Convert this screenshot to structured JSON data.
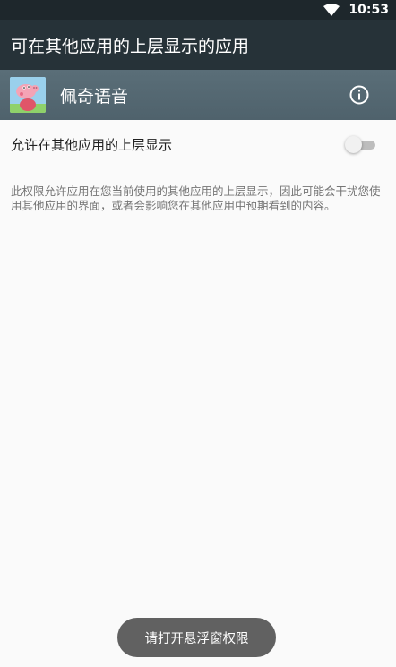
{
  "status_bar": {
    "time": "10:53",
    "wifi_icon": "wifi-icon"
  },
  "app_bar": {
    "title": "可在其他应用的上层显示的应用"
  },
  "app_header": {
    "name": "佩奇语音",
    "icon": "peppa-app-icon",
    "info_icon": "info-icon"
  },
  "setting": {
    "label": "允许在其他应用的上层显示",
    "enabled": false
  },
  "description": "此权限允许应用在您当前使用的其他应用的上层显示，因此可能会干扰您使用其他应用的界面，或者会影响您在其他应用中预期看到的内容。",
  "toast": {
    "text": "请打开悬浮窗权限"
  },
  "colors": {
    "status_bar": "#1e272c",
    "app_bar": "#263238",
    "app_header": "#546e7a",
    "toast_bg": "#616161"
  }
}
